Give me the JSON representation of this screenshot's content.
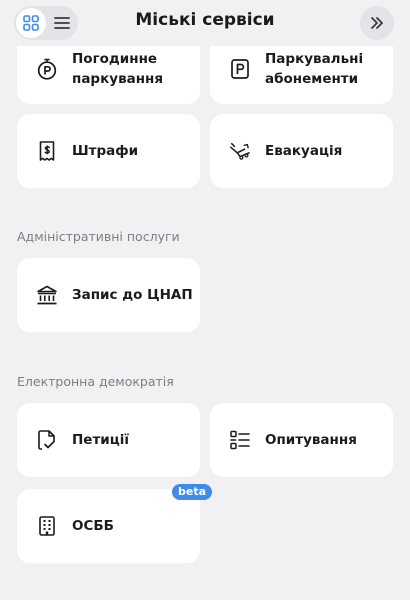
{
  "header": {
    "title": "Міські сервіси"
  },
  "transport": {
    "hourly_parking": "Погодинне\nпаркування",
    "parking_subscriptions": "Паркувальні\nабонементи",
    "fines": "Штрафи",
    "evacuation": "Евакуація"
  },
  "admin": {
    "section_title": "Адміністративні послуги",
    "cnap": "Запис до ЦНАП"
  },
  "democracy": {
    "section_title": "Електронна демократія",
    "petitions": "Петиції",
    "polls": "Опитування",
    "osbb": "ОСББ",
    "osbb_badge": "beta"
  },
  "colors": {
    "background": "#f1f1f3",
    "card": "#ffffff",
    "accent": "#3f8be8",
    "muted_text": "#7d7d85"
  },
  "icons": [
    "grid-icon",
    "list-icon",
    "double-chevron-right-icon",
    "stopwatch-parking-icon",
    "parking-ticket-icon",
    "receipt-icon",
    "tow-truck-icon",
    "government-building-icon",
    "document-check-icon",
    "checklist-icon",
    "apartment-building-icon"
  ]
}
